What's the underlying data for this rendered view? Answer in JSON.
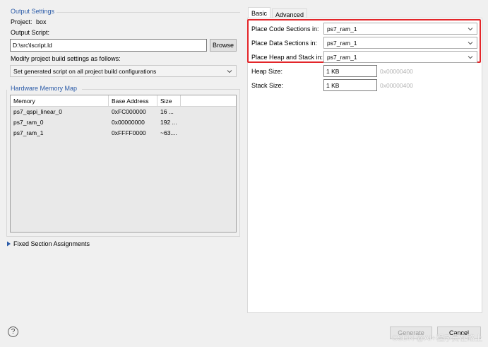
{
  "output_settings": {
    "title": "Output Settings",
    "project_label": "Project:",
    "project_value": "box",
    "script_label": "Output Script:",
    "script_value": "D:\\src\\lscript.ld",
    "browse_label": "Browse",
    "modify_label": "Modify project build settings as follows:",
    "modify_selected": "Set generated script on all project build configurations"
  },
  "hardware_memory_map": {
    "title": "Hardware Memory Map",
    "columns": [
      "Memory",
      "Base Address",
      "Size"
    ],
    "rows": [
      [
        "ps7_qspi_linear_0",
        "0xFC000000",
        "16 ..."
      ],
      [
        "ps7_ram_0",
        "0x00000000",
        "192 ..."
      ],
      [
        "ps7_ram_1",
        "0xFFFF0000",
        "~63...."
      ]
    ]
  },
  "fixed_section": {
    "label": "Fixed Section Assignments"
  },
  "tabs": [
    {
      "label": "Basic",
      "active": true
    },
    {
      "label": "Advanced",
      "active": false
    }
  ],
  "basic": {
    "code_label": "Place Code Sections in:",
    "code_value": "ps7_ram_1",
    "data_label": "Place Data Sections in:",
    "data_value": "ps7_ram_1",
    "heap_stack_label": "Place Heap and Stack in:",
    "heap_stack_value": "ps7_ram_1",
    "heap_label": "Heap Size:",
    "heap_value": "1 KB",
    "heap_hint": "0x00000400",
    "stack_label": "Stack Size:",
    "stack_value": "1 KB",
    "stack_hint": "0x00000400"
  },
  "footer": {
    "help_icon": "?",
    "generate_label": "Generate",
    "cancel_label": "Cancel",
    "watermark": "CSDN @AI+程序员在路上"
  },
  "colors": {
    "group_title": "#2b5ba8",
    "highlight": "#e3262a"
  }
}
